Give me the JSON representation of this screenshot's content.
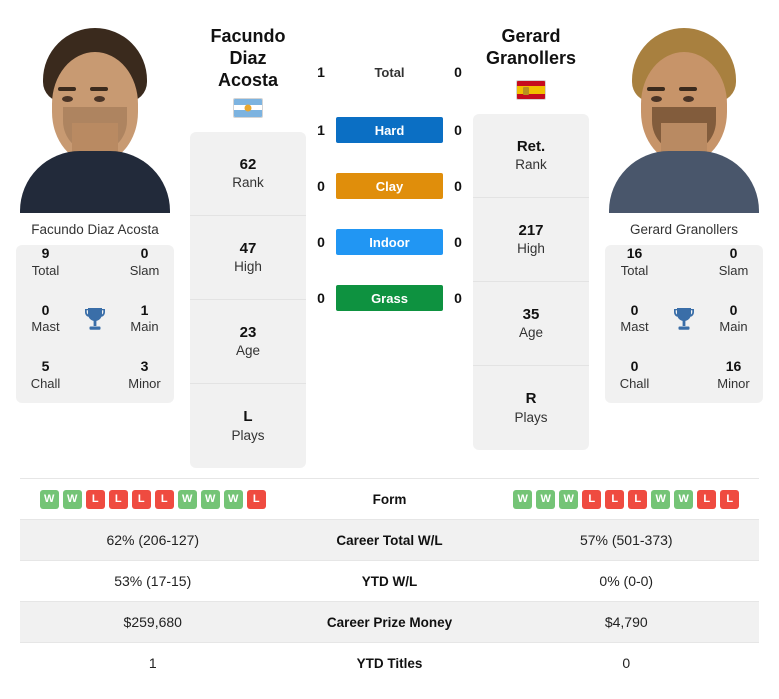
{
  "players": {
    "left": {
      "name": "Facundo Diaz Acosta",
      "name_display": "Facundo Diaz\nAcosta",
      "name_line1": "Facundo Diaz",
      "name_line2": "Acosta",
      "country": "Argentina",
      "flag": "argentina-flag",
      "rank": "62",
      "rank_label": "Rank",
      "high": "47",
      "high_label": "High",
      "age": "23",
      "age_label": "Age",
      "plays": "L",
      "plays_label": "Plays",
      "titles": {
        "total": "9",
        "total_label": "Total",
        "slam": "0",
        "slam_label": "Slam",
        "mast": "0",
        "mast_label": "Mast",
        "main": "1",
        "main_label": "Main",
        "chall": "5",
        "chall_label": "Chall",
        "minor": "3",
        "minor_label": "Minor"
      },
      "form": [
        "W",
        "W",
        "L",
        "L",
        "L",
        "L",
        "W",
        "W",
        "W",
        "L"
      ],
      "career_total_wl": "62% (206-127)",
      "ytd_wl": "53% (17-15)",
      "career_prize_money": "$259,680",
      "ytd_titles": "1"
    },
    "right": {
      "name": "Gerard Granollers",
      "name_line1": "Gerard",
      "name_line2": "Granollers",
      "country": "Spain",
      "flag": "spain-flag",
      "rank": "Ret.",
      "rank_label": "Rank",
      "high": "217",
      "high_label": "High",
      "age": "35",
      "age_label": "Age",
      "plays": "R",
      "plays_label": "Plays",
      "titles": {
        "total": "16",
        "total_label": "Total",
        "slam": "0",
        "slam_label": "Slam",
        "mast": "0",
        "mast_label": "Mast",
        "main": "0",
        "main_label": "Main",
        "chall": "0",
        "chall_label": "Chall",
        "minor": "16",
        "minor_label": "Minor"
      },
      "form": [
        "W",
        "W",
        "W",
        "L",
        "L",
        "L",
        "W",
        "W",
        "L",
        "L"
      ],
      "career_total_wl": "57% (501-373)",
      "ytd_wl": "0% (0-0)",
      "career_prize_money": "$4,790",
      "ytd_titles": "0"
    }
  },
  "head_to_head": [
    {
      "label": "Total",
      "left": "1",
      "right": "0",
      "type": "plain",
      "color": ""
    },
    {
      "label": "Hard",
      "left": "1",
      "right": "0",
      "type": "pill",
      "color": "#0b6fc4"
    },
    {
      "label": "Clay",
      "left": "0",
      "right": "0",
      "type": "pill",
      "color": "#e08e0b"
    },
    {
      "label": "Indoor",
      "left": "0",
      "right": "0",
      "type": "pill",
      "color": "#2196f3"
    },
    {
      "label": "Grass",
      "left": "0",
      "right": "0",
      "type": "pill",
      "color": "#0e9240"
    }
  ],
  "table_rows": [
    {
      "label": "Form",
      "left": "",
      "right": "",
      "kind": "form",
      "alt": false
    },
    {
      "label": "Career Total W/L",
      "left": "62% (206-127)",
      "right": "57% (501-373)",
      "kind": "text",
      "alt": true
    },
    {
      "label": "YTD W/L",
      "left": "53% (17-15)",
      "right": "0% (0-0)",
      "kind": "text",
      "alt": false
    },
    {
      "label": "Career Prize Money",
      "left": "$259,680",
      "right": "$4,790",
      "kind": "text",
      "alt": true
    },
    {
      "label": "YTD Titles",
      "left": "1",
      "right": "0",
      "kind": "text",
      "alt": false
    }
  ],
  "colors": {
    "hard": "#0b6fc4",
    "clay": "#e08e0b",
    "indoor": "#2196f3",
    "grass": "#0e9240",
    "win": "#74c476",
    "loss": "#ef4b40",
    "trophy": "#3a6ea8",
    "card_bg": "#f1f1f1"
  }
}
